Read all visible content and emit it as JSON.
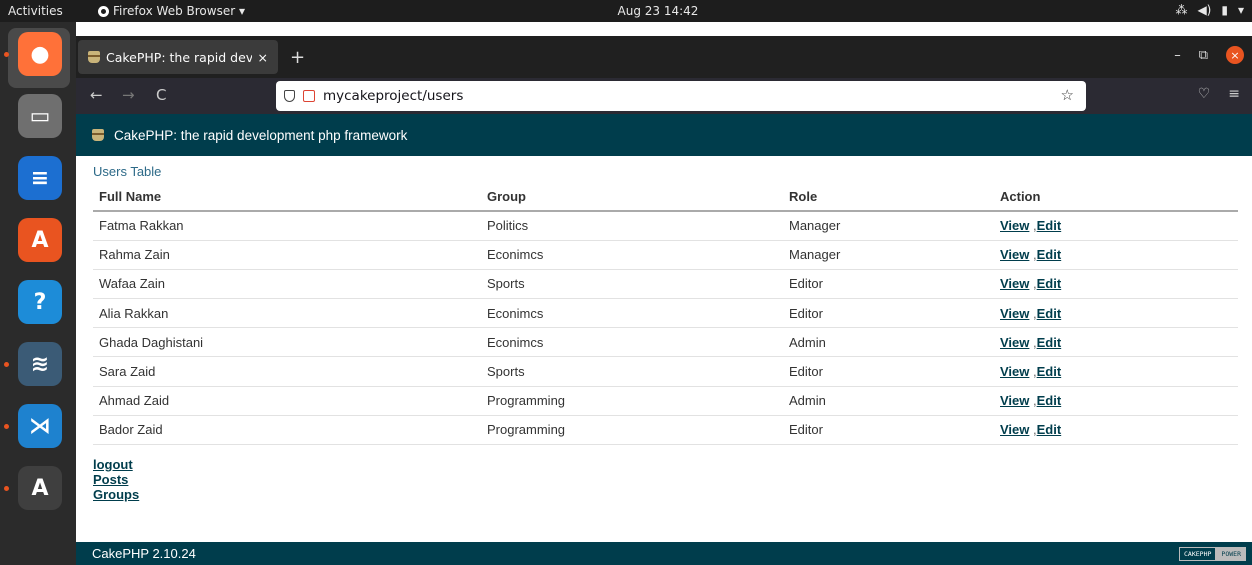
{
  "system": {
    "activities": "Activities",
    "app_menu": "Firefox Web Browser ▾",
    "clock": "Aug 23  14:42",
    "tray": [
      "⁂",
      "◀)",
      "▮",
      "▾"
    ]
  },
  "dock": {
    "apps": [
      {
        "name": "firefox",
        "glyph": "●",
        "color": "#ff7139"
      },
      {
        "name": "files",
        "glyph": "▭",
        "color": "#6f6f6f"
      },
      {
        "name": "writer",
        "glyph": "≡",
        "color": "#1c6fd1"
      },
      {
        "name": "software",
        "glyph": "A",
        "color": "#e95420"
      },
      {
        "name": "help",
        "glyph": "?",
        "color": "#1d8cd8"
      },
      {
        "name": "mysql-workbench",
        "glyph": "≋",
        "color": "#3b5b76"
      },
      {
        "name": "vscode",
        "glyph": "⋊",
        "color": "#1e82cf"
      },
      {
        "name": "updater",
        "glyph": "A",
        "color": "#3f3f3f"
      }
    ]
  },
  "browser": {
    "tab_title": "CakePHP: the rapid devel",
    "tab_close": "×",
    "new_tab": "+",
    "controls": {
      "minimize": "–",
      "restore": "⧉",
      "close": "×"
    },
    "nav": {
      "back": "←",
      "forward": "→",
      "reload": "C"
    },
    "url": "mycakeproject/users",
    "bookmark": "☆",
    "pocket": "♡",
    "menu": "≡"
  },
  "page": {
    "header_title": "CakePHP: the rapid development php framework",
    "section_title": "Users Table",
    "columns": [
      "Full Name",
      "Group",
      "Role",
      "Action"
    ],
    "rows": [
      {
        "name": "Fatma Rakkan",
        "group": "Politics",
        "role": "Manager"
      },
      {
        "name": "Rahma Zain",
        "group": "Econimcs",
        "role": "Manager"
      },
      {
        "name": "Wafaa Zain",
        "group": "Sports",
        "role": "Editor"
      },
      {
        "name": "Alia Rakkan",
        "group": "Econimcs",
        "role": "Editor"
      },
      {
        "name": "Ghada Daghistani",
        "group": "Econimcs",
        "role": "Admin"
      },
      {
        "name": "Sara Zaid",
        "group": "Sports",
        "role": "Editor"
      },
      {
        "name": "Ahmad Zaid",
        "group": "Programming",
        "role": "Admin"
      },
      {
        "name": "Bador Zaid",
        "group": "Programming",
        "role": "Editor"
      }
    ],
    "action_view": "View",
    "action_sep": " ,",
    "action_edit": "Edit",
    "links": {
      "logout": "logout",
      "posts": "Posts",
      "groups": "Groups"
    },
    "footer_version": "CakePHP 2.10.24",
    "powered_a": "CAKEPHP",
    "powered_b": "POWER"
  }
}
